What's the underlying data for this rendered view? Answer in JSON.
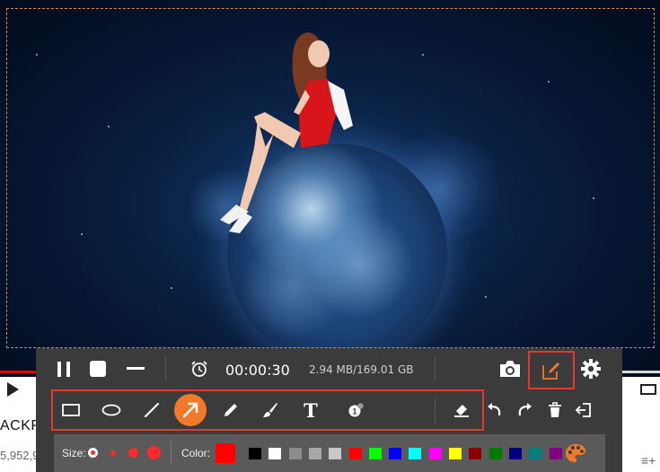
{
  "recorder": {
    "time": "00:00:30",
    "size": "2.94 MB/169.01 GB",
    "size_label": "Size:",
    "color_label": "Color:",
    "current_color": "#ff0000",
    "swatches": [
      "#000000",
      "#ffffff",
      "#8c8c8c",
      "#a8a8a8",
      "#c8c8c8",
      "#ff0000",
      "#00ff00",
      "#0000ff",
      "#00ffff",
      "#ff00ff",
      "#ffff00",
      "#8b0000",
      "#007a00",
      "#000080",
      "#008080",
      "#800080"
    ],
    "icons": {
      "pause": "pause-icon",
      "stop": "stop-icon",
      "minimize": "minimize-icon",
      "alarm": "alarm-clock-icon",
      "camera": "camera-icon",
      "edit": "edit-pencil-icon",
      "settings": "gear-icon",
      "tools": [
        "rectangle-icon",
        "ellipse-icon",
        "line-icon",
        "arrow-icon",
        "pencil-icon",
        "brush-icon",
        "text-icon",
        "step-number-icon",
        "eraser-icon",
        "undo-icon",
        "redo-icon",
        "trash-icon",
        "exit-icon"
      ],
      "palette": "palette-icon"
    },
    "accent": "#f07a2a",
    "highlight": "#e23b2e"
  },
  "player": {
    "title_fragment": "ACKP",
    "views_fragment": "5,952,9",
    "icons": [
      "play-icon",
      "theater-mode-icon",
      "add-to-queue-icon"
    ]
  }
}
